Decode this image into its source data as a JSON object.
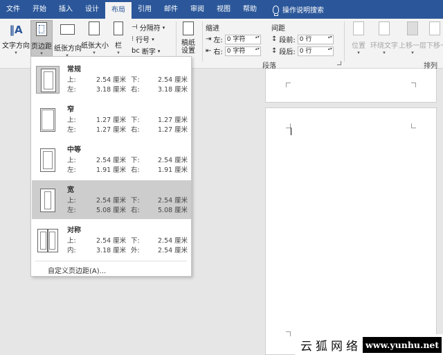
{
  "tabs": [
    "文件",
    "开始",
    "插入",
    "设计",
    "布局",
    "引用",
    "邮件",
    "审阅",
    "视图",
    "帮助"
  ],
  "active_tab": "布局",
  "search_label": "操作说明搜索",
  "ribbon": {
    "text_direction": "文字方向",
    "margins": "页边距",
    "orientation": "纸张方向",
    "size": "纸张大小",
    "columns": "栏",
    "breaks": "分隔符",
    "line_numbers": "行号",
    "hyphenation": "断字",
    "draft_paper": "稿纸\n设置",
    "indent_label": "缩进",
    "indent_left_label": "左:",
    "indent_left_value": "0 字符",
    "indent_right_label": "右:",
    "indent_right_value": "0 字符",
    "spacing_label": "间距",
    "spacing_before_label": "段前:",
    "spacing_before_value": "0 行",
    "spacing_after_label": "段后:",
    "spacing_after_value": "0 行",
    "paragraph_group": "段落",
    "position": "位置",
    "wrap_text": "环绕文字",
    "bring_forward": "上移一层",
    "send_backward": "下移一",
    "arrange_group": "排列"
  },
  "margins_menu": {
    "options": [
      {
        "name": "常规",
        "top_label": "上:",
        "top": "2.54 厘米",
        "bottom_label": "下:",
        "bottom": "2.54 厘米",
        "left_label": "左:",
        "left": "3.18 厘米",
        "right_label": "右:",
        "right": "3.18 厘米"
      },
      {
        "name": "窄",
        "top_label": "上:",
        "top": "1.27 厘米",
        "bottom_label": "下:",
        "bottom": "1.27 厘米",
        "left_label": "左:",
        "left": "1.27 厘米",
        "right_label": "右:",
        "right": "1.27 厘米"
      },
      {
        "name": "中等",
        "top_label": "上:",
        "top": "2.54 厘米",
        "bottom_label": "下:",
        "bottom": "2.54 厘米",
        "left_label": "左:",
        "left": "1.91 厘米",
        "right_label": "右:",
        "right": "1.91 厘米"
      },
      {
        "name": "宽",
        "top_label": "上:",
        "top": "2.54 厘米",
        "bottom_label": "下:",
        "bottom": "2.54 厘米",
        "left_label": "左:",
        "left": "5.08 厘米",
        "right_label": "右:",
        "right": "5.08 厘米"
      },
      {
        "name": "对称",
        "top_label": "上:",
        "top": "2.54 厘米",
        "bottom_label": "下:",
        "bottom": "2.54 厘米",
        "left_label": "内:",
        "left": "3.18 厘米",
        "right_label": "外:",
        "right": "2.54 厘米"
      }
    ],
    "custom": "自定义页边距(A)..."
  },
  "watermark": {
    "cn": "云狐网络",
    "en": "www.yunhu.net"
  }
}
